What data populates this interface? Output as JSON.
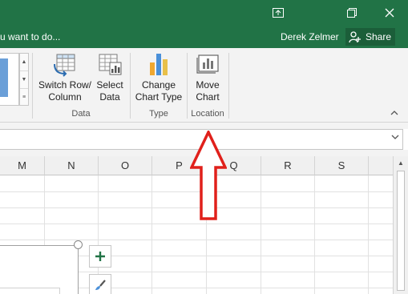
{
  "titlebar": {
    "accent": "#217346",
    "icons": [
      "ribbon-display-icon",
      "restore-icon",
      "close-icon"
    ]
  },
  "tellbar": {
    "tell_me_text": "u want to do...",
    "user_name": "Derek Zelmer",
    "share_label": "Share"
  },
  "ribbon": {
    "groups": [
      {
        "label": "Data",
        "buttons": [
          {
            "line1": "Switch Row/",
            "line2": "Column",
            "icon": "switch-row-column-icon"
          },
          {
            "line1": "Select",
            "line2": "Data",
            "icon": "select-data-icon"
          }
        ]
      },
      {
        "label": "Type",
        "buttons": [
          {
            "line1": "Change",
            "line2": "Chart Type",
            "icon": "change-chart-type-icon"
          }
        ]
      },
      {
        "label": "Location",
        "buttons": [
          {
            "line1": "Move",
            "line2": "Chart",
            "icon": "move-chart-icon"
          }
        ]
      }
    ]
  },
  "grid": {
    "columns": [
      "M",
      "N",
      "O",
      "P",
      "Q",
      "R",
      "S"
    ]
  },
  "chart_tools": {
    "icons": [
      "chart-elements-plus-icon",
      "chart-styles-brush-icon"
    ]
  },
  "annotation": {
    "arrow_color": "#e0201b",
    "icon": "up-arrow-annotation-icon"
  }
}
